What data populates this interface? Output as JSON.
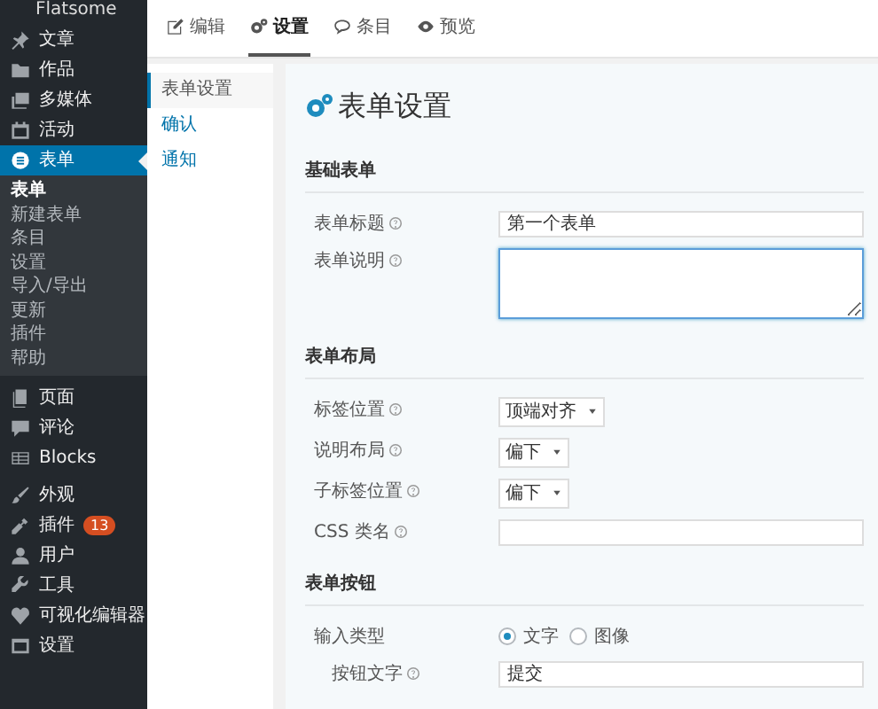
{
  "sidebar": {
    "brand": "Flatsome",
    "items": [
      {
        "label": "文章",
        "selected": false
      },
      {
        "label": "作品",
        "selected": false
      },
      {
        "label": "多媒体",
        "selected": false
      },
      {
        "label": "活动",
        "selected": false
      },
      {
        "label": "表单",
        "selected": true,
        "children": [
          {
            "label": "表单",
            "selected": true
          },
          {
            "label": "新建表单",
            "selected": false
          },
          {
            "label": "条目",
            "selected": false
          },
          {
            "label": "设置",
            "selected": false
          },
          {
            "label": "导入/导出",
            "selected": false
          },
          {
            "label": "更新",
            "selected": false
          },
          {
            "label": "插件",
            "selected": false
          },
          {
            "label": "帮助",
            "selected": false
          }
        ]
      },
      {
        "label": "页面",
        "selected": false,
        "group_start": true
      },
      {
        "label": "评论",
        "selected": false
      },
      {
        "label": "Blocks",
        "selected": false
      },
      {
        "label": "外观",
        "selected": false,
        "group_start": true
      },
      {
        "label": "插件",
        "selected": false,
        "badge": "13"
      },
      {
        "label": "用户",
        "selected": false
      },
      {
        "label": "工具",
        "selected": false
      },
      {
        "label": "可视化编辑器",
        "selected": false
      },
      {
        "label": "设置",
        "selected": false
      }
    ]
  },
  "tabs": [
    {
      "label": "编辑",
      "selected": false
    },
    {
      "label": "设置",
      "selected": true
    },
    {
      "label": "条目",
      "selected": false
    },
    {
      "label": "预览",
      "selected": false
    }
  ],
  "subnav": [
    {
      "label": "表单设置",
      "selected": true
    },
    {
      "label": "确认",
      "selected": false
    },
    {
      "label": "通知",
      "selected": false
    }
  ],
  "panel": {
    "title": "表单设置",
    "sections": [
      {
        "title": "基础表单",
        "fields": [
          {
            "kind": "text",
            "label": "表单标题",
            "help": true,
            "value": "第一个表单"
          },
          {
            "kind": "textarea",
            "label": "表单说明",
            "help": true,
            "focused": true
          }
        ]
      },
      {
        "title": "表单布局",
        "fields": [
          {
            "kind": "select",
            "label": "标签位置",
            "help": true,
            "value": "顶端对齐"
          },
          {
            "kind": "select",
            "label": "说明布局",
            "help": true,
            "value": "偏下"
          },
          {
            "kind": "select",
            "label": "子标签位置",
            "help": true,
            "value": "偏下"
          },
          {
            "kind": "text",
            "label": "CSS 类名",
            "help": true
          }
        ]
      },
      {
        "title": "表单按钮",
        "fields": [
          {
            "kind": "radio",
            "label": "输入类型",
            "options": [
              {
                "label": "文字",
                "selected": true
              },
              {
                "label": "图像",
                "selected": false
              }
            ]
          },
          {
            "kind": "text",
            "label": "按钮文字",
            "help": true,
            "value": "提交",
            "indented": true
          }
        ]
      }
    ]
  }
}
